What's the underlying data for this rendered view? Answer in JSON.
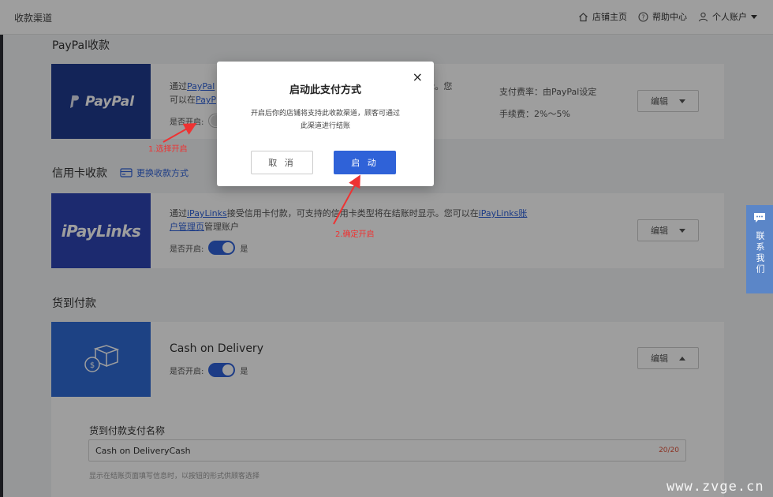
{
  "topbar": {
    "title": "收款渠道",
    "nav": [
      "店铺主页",
      "帮助中心",
      "个人账户"
    ]
  },
  "paypal": {
    "section_title": "PayPal收款",
    "logo_text": "PayPal",
    "desc_line1_a": "通过",
    "desc_line1_link": "PayPal",
    "desc_line1_tail": "时显示。您",
    "desc_line2_a": "可以在",
    "desc_line2_link": "PayP",
    "enable_label": "是否开启:",
    "fee_label": "支付费率：由PayPal设定",
    "fee2_label": "手续费：2%～5%",
    "edit_label": "编辑"
  },
  "credit": {
    "section_title": "信用卡收款",
    "switch_label": "更换收款方式",
    "logo_text": "iPayLinks",
    "desc_a": "通过",
    "desc_link1": "iPayLinks",
    "desc_b": "接受信用卡付款，可支持的信用卡类型将在结账时显示。您可以在",
    "desc_link2": "iPayLinks账",
    "desc_link3": "户管理页",
    "desc_c": "管理账户",
    "enable_label": "是否开启:",
    "enable_state": "是",
    "edit_label": "编辑"
  },
  "cod": {
    "section_title": "货到付款",
    "name": "Cash on Delivery",
    "enable_label": "是否开启:",
    "enable_state": "是",
    "edit_label": "编辑",
    "field_label": "货到付款支付名称",
    "field_value": "Cash on DeliveryCash",
    "counter": "20/20",
    "hint": "显示在结账页面填写信息时，以按钮的形式供顾客选择"
  },
  "modal": {
    "title": "启动此支付方式",
    "message": "开启后你的店铺将支持此收款渠道，顾客可通过此渠道进行结账",
    "cancel_label": "取 消",
    "confirm_label": "启 动"
  },
  "annotations": {
    "step1": "1.选择开启",
    "step2": "2.确定开启"
  },
  "contact": {
    "label": "联系我们"
  },
  "watermark": "www.zvge.cn",
  "colors": {
    "primary": "#2f62d8",
    "annotation": "#e33333",
    "paypal_logo_bg": "#1f3a8f",
    "ipay_logo_bg": "#2e45b3",
    "cod_logo_bg": "#2f6bd6"
  }
}
